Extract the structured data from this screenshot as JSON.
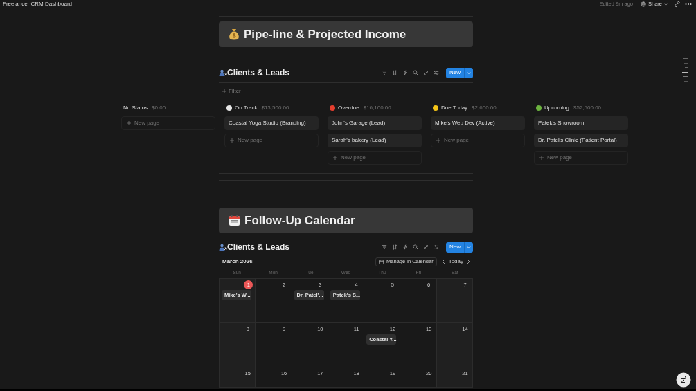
{
  "topbar": {
    "title": "Freelancer CRM Dashboard",
    "edited": "Edited 9m ago",
    "share": "Share"
  },
  "pipeline": {
    "banner": "Pipe-line & Projected Income",
    "view_title": "Clients & Leads",
    "new_button": "New",
    "filter": "Filter",
    "groups": [
      {
        "name": "No Status",
        "total": "$0.00",
        "new_page": "New page"
      },
      {
        "name": "On Track",
        "total": "$13,500.00",
        "color": "#e6e6e6",
        "cards": [
          "Coastal Yoga Studio (Branding)"
        ],
        "new_page": "New page"
      },
      {
        "name": "Overdue",
        "total": "$16,100.00",
        "color": "#e53e2e",
        "cards": [
          "John's Garage (Lead)",
          "Sarah's bakery (Lead)"
        ],
        "new_page": "New page"
      },
      {
        "name": "Due Today",
        "total": "$2,600.00",
        "color": "#f5c518",
        "cards": [
          "Mike's Web Dev (Active)"
        ],
        "new_page": "New page"
      },
      {
        "name": "Upcoming",
        "total": "$52,500.00",
        "color": "#6cb33f",
        "cards": [
          "Patek's Showroom",
          "Dr. Patel's Clinic (Patient Portal)"
        ],
        "new_page": "New page"
      }
    ]
  },
  "calendar": {
    "banner": "Follow-Up Calendar",
    "view_title": "Clients & Leads",
    "new_button": "New",
    "month": "March 2026",
    "manage": "Manage in Calendar",
    "today_button": "Today",
    "weekdays": [
      "Sun",
      "Mon",
      "Tue",
      "Wed",
      "Thu",
      "Fri",
      "Sat"
    ],
    "weeks": [
      [
        {
          "day": "1",
          "today": true,
          "events": [
            "Mike's W..."
          ]
        },
        {
          "day": "2",
          "today": false
        },
        {
          "day": "3",
          "today": false,
          "events": [
            "Dr. Patel'..."
          ]
        },
        {
          "day": "4",
          "today": false,
          "events": [
            "Patek's S..."
          ]
        },
        {
          "day": "5",
          "today": false
        },
        {
          "day": "6",
          "today": false
        },
        {
          "day": "7",
          "today": false
        }
      ],
      [
        {
          "day": "8",
          "today": false
        },
        {
          "day": "9",
          "today": false
        },
        {
          "day": "10",
          "today": false
        },
        {
          "day": "11",
          "today": false
        },
        {
          "day": "12",
          "today": false,
          "events": [
            "Coastal Y..."
          ]
        },
        {
          "day": "13",
          "today": false
        },
        {
          "day": "14",
          "today": false
        }
      ],
      [
        {
          "day": "15",
          "today": false
        },
        {
          "day": "16",
          "today": false
        },
        {
          "day": "17",
          "today": false
        },
        {
          "day": "18",
          "today": false
        },
        {
          "day": "19",
          "today": false
        },
        {
          "day": "20",
          "today": false
        },
        {
          "day": "21",
          "today": false
        }
      ]
    ]
  }
}
